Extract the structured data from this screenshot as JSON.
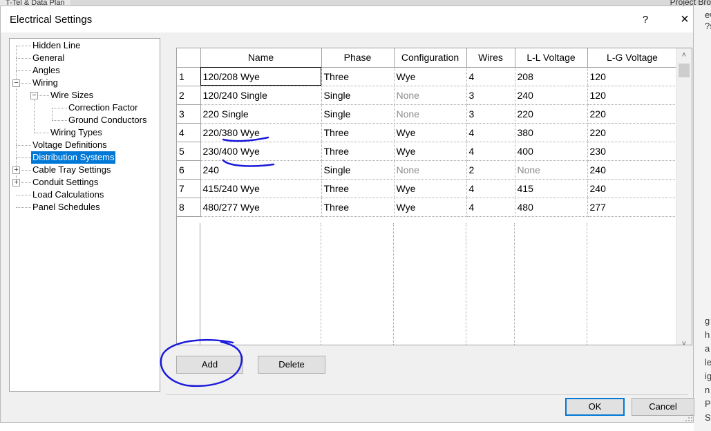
{
  "background": {
    "tab_label": "T-Tel & Data Plan",
    "right_panel_title": "Project Bro",
    "right_edge_letters": [
      "g",
      "h",
      "a",
      "le",
      "ig",
      "n",
      "P",
      "She"
    ],
    "top_right_letters": [
      "ew",
      "?s"
    ]
  },
  "dialog": {
    "title": "Electrical Settings",
    "help_label": "?",
    "close_label": "×",
    "ok_label": "OK",
    "cancel_label": "Cancel"
  },
  "tree": {
    "items": [
      {
        "label": "Hidden Line"
      },
      {
        "label": "General"
      },
      {
        "label": "Angles"
      },
      {
        "label": "Wiring",
        "expander": "−"
      },
      {
        "label": "Wire Sizes",
        "expander": "−"
      },
      {
        "label": "Correction Factor"
      },
      {
        "label": "Ground Conductors"
      },
      {
        "label": "Wiring Types"
      },
      {
        "label": "Voltage Definitions"
      },
      {
        "label": "Distribution Systems",
        "selected": true
      },
      {
        "label": "Cable Tray Settings",
        "expander": "+"
      },
      {
        "label": "Conduit Settings",
        "expander": "+"
      },
      {
        "label": "Load Calculations"
      },
      {
        "label": "Panel Schedules"
      }
    ]
  },
  "grid": {
    "columns": [
      "Name",
      "Phase",
      "Configuration",
      "Wires",
      "L-L Voltage",
      "L-G Voltage"
    ],
    "rows": [
      {
        "num": "1",
        "name": "120/208 Wye",
        "phase": "Three",
        "config": "Wye",
        "wires": "4",
        "ll": "208",
        "lg": "120"
      },
      {
        "num": "2",
        "name": "120/240 Single",
        "phase": "Single",
        "config": "None",
        "wires": "3",
        "ll": "240",
        "lg": "120"
      },
      {
        "num": "3",
        "name": "220 Single",
        "phase": "Single",
        "config": "None",
        "wires": "3",
        "ll": "220",
        "lg": "220"
      },
      {
        "num": "4",
        "name": "220/380 Wye",
        "phase": "Three",
        "config": "Wye",
        "wires": "4",
        "ll": "380",
        "lg": "220"
      },
      {
        "num": "5",
        "name": "230/400 Wye",
        "phase": "Three",
        "config": "Wye",
        "wires": "4",
        "ll": "400",
        "lg": "230"
      },
      {
        "num": "6",
        "name": "240",
        "phase": "Single",
        "config": "None",
        "wires": "2",
        "ll": "None",
        "lg": "240"
      },
      {
        "num": "7",
        "name": "415/240 Wye",
        "phase": "Three",
        "config": "Wye",
        "wires": "4",
        "ll": "415",
        "lg": "240"
      },
      {
        "num": "8",
        "name": "480/277 Wye",
        "phase": "Three",
        "config": "Wye",
        "wires": "4",
        "ll": "480",
        "lg": "277"
      }
    ],
    "muted_value": "None"
  },
  "buttons": {
    "add_label": "Add",
    "delete_label": "Delete"
  },
  "colors": {
    "selection": "#0078d7",
    "annotation_ink": "#1a1adb"
  }
}
